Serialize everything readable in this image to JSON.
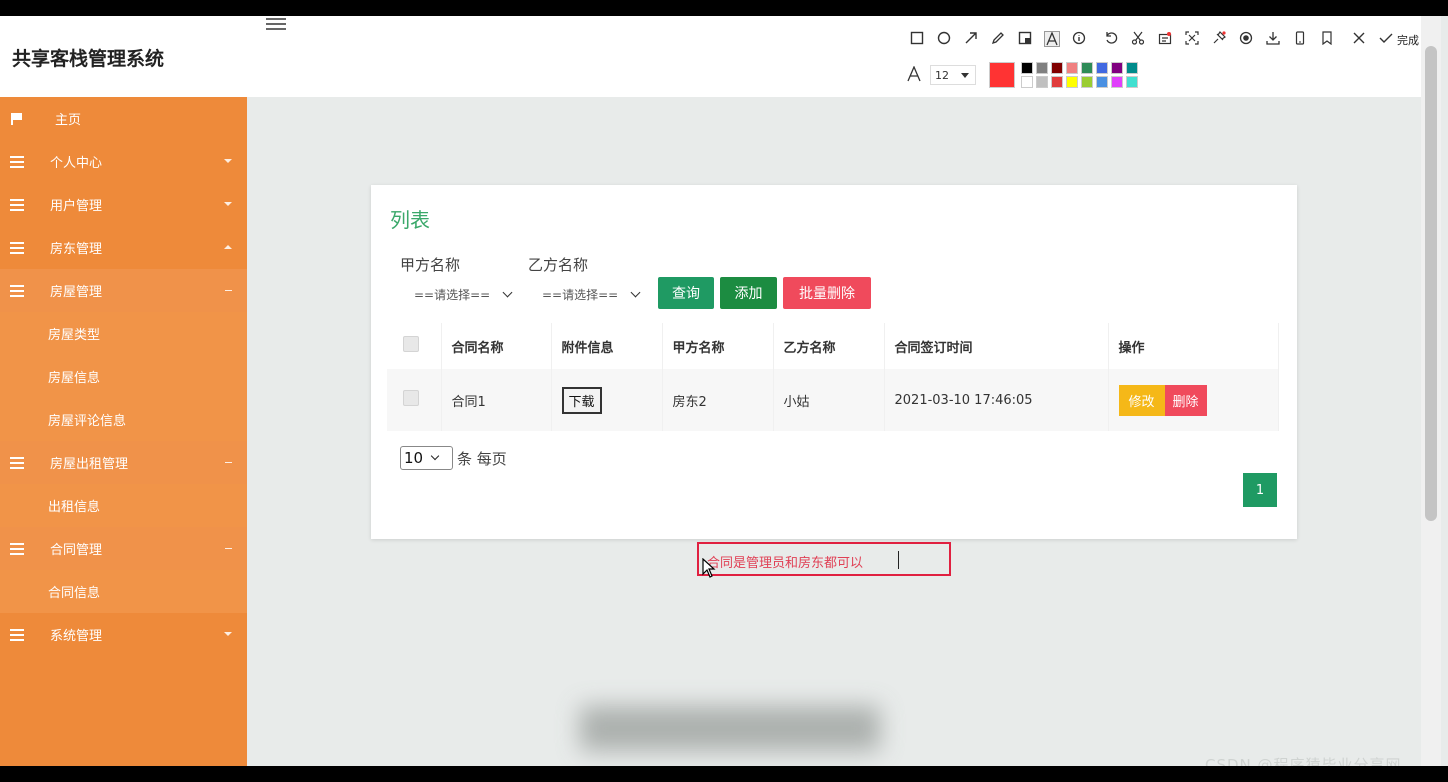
{
  "app": {
    "title": "共享客栈管理系统"
  },
  "sidebar": {
    "items": [
      {
        "label": "主页",
        "icon": "flag-icon",
        "child": false
      },
      {
        "label": "个人中心",
        "icon": "list-icon",
        "child": false,
        "caret": "down"
      },
      {
        "label": "用户管理",
        "icon": "list-icon",
        "child": false,
        "caret": "down"
      },
      {
        "label": "房东管理",
        "icon": "list-icon",
        "child": false,
        "caret": "up"
      },
      {
        "label": "房屋管理",
        "icon": "list-icon",
        "child": false,
        "caret": "flat"
      },
      {
        "label": "房屋类型",
        "child": true
      },
      {
        "label": "房屋信息",
        "child": true
      },
      {
        "label": "房屋评论信息",
        "child": true
      },
      {
        "label": "房屋出租管理",
        "icon": "list-icon",
        "child": false,
        "caret": "flat"
      },
      {
        "label": "出租信息",
        "child": true
      },
      {
        "label": "合同管理",
        "icon": "list-icon",
        "child": false,
        "caret": "flat"
      },
      {
        "label": "合同信息",
        "child": true
      },
      {
        "label": "系统管理",
        "icon": "list-icon",
        "child": false,
        "caret": "down"
      }
    ]
  },
  "panel": {
    "title": "列表",
    "filters": {
      "party_a_label": "甲方名称",
      "party_a_value": "==请选择==",
      "party_b_label": "乙方名称",
      "party_b_value": "==请选择=="
    },
    "buttons": {
      "query": "查询",
      "add": "添加",
      "batch_delete": "批量删除"
    },
    "table": {
      "headers": [
        "合同名称",
        "附件信息",
        "甲方名称",
        "乙方名称",
        "合同签订时间",
        "操作"
      ],
      "rows": [
        {
          "contract_name": "合同1",
          "attachment": "下载",
          "party_a": "房东2",
          "party_b": "小姑",
          "signed_at": "2021-03-10 17:46:05",
          "edit": "修改",
          "delete": "删除"
        }
      ]
    },
    "pagination": {
      "page_size": "10",
      "page_size_suffix": "条 每页",
      "current_page": "1"
    }
  },
  "annotation": {
    "text": "合同是管理员和房东都可以"
  },
  "snip_toolbar": {
    "done_label": "完成",
    "font_size": "12",
    "current_color": "#ff3333",
    "palette_top": [
      "#000000",
      "#808080",
      "#800000",
      "#f08080",
      "#2e8b57",
      "#4169e1",
      "#800080",
      "#008b8b"
    ],
    "palette_bottom": [
      "#ffffff",
      "#c0c0c0",
      "#e03c3c",
      "#ffff00",
      "#9acd32",
      "#4a90e2",
      "#e040fb",
      "#40e0d0"
    ]
  },
  "watermark": "CSDN @程序猿毕业分享网",
  "colors": {
    "sidebar": "#ee8a3a",
    "accent_green": "#1f9a63",
    "danger": "#f04a5c",
    "warning": "#f5b818"
  }
}
